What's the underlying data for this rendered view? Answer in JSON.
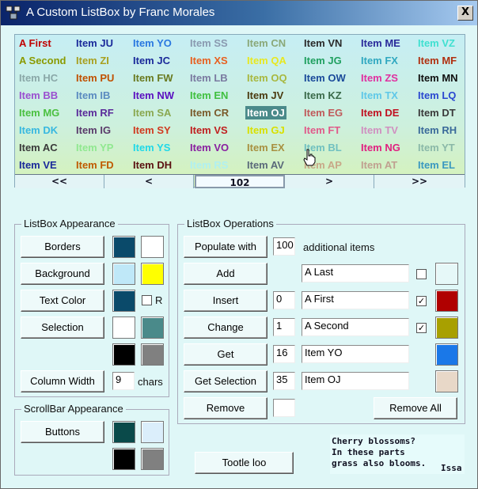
{
  "window": {
    "title": "A Custom ListBox by Franc Morales",
    "close_glyph": "X"
  },
  "listbox": {
    "columns": [
      [
        [
          "A First",
          "#c00000"
        ],
        [
          "A Second",
          "#8a9a00"
        ],
        [
          "Item HC",
          "#8aa8a8"
        ],
        [
          "Item BB",
          "#9a4fd0"
        ],
        [
          "Item MG",
          "#4bc040"
        ],
        [
          "Item DK",
          "#38b8e0"
        ],
        [
          "Item AC",
          "#3a3a3a"
        ],
        [
          "Item VE",
          "#1a2a9a"
        ]
      ],
      [
        [
          "Item JU",
          "#1a2a9a"
        ],
        [
          "Item ZI",
          "#a8a020"
        ],
        [
          "Item PU",
          "#c05000"
        ],
        [
          "Item IB",
          "#5a8ac0"
        ],
        [
          "Item RF",
          "#5a2a9a"
        ],
        [
          "Item IG",
          "#5a3a6a"
        ],
        [
          "Item YP",
          "#90e890"
        ],
        [
          "Item FD",
          "#c05a00"
        ]
      ],
      [
        [
          "Item YO",
          "#2a78e0"
        ],
        [
          "Item JC",
          "#1a2a9a"
        ],
        [
          "Item FW",
          "#6a7a20"
        ],
        [
          "Item NW",
          "#5a10c0"
        ],
        [
          "Item SA",
          "#8aa850"
        ],
        [
          "Item SY",
          "#d03a20"
        ],
        [
          "Item YS",
          "#20d8e8"
        ],
        [
          "Item DH",
          "#5a1010"
        ]
      ],
      [
        [
          "Item SS",
          "#8a9ab0"
        ],
        [
          "Item XS",
          "#e86020"
        ],
        [
          "Item LB",
          "#7a7aa0"
        ],
        [
          "Item EN",
          "#40c040"
        ],
        [
          "Item CR",
          "#7a5a2a"
        ],
        [
          "Item VS",
          "#c02020"
        ],
        [
          "Item VO",
          "#8a20a0"
        ],
        [
          "Item RS",
          "#b0f0f0"
        ]
      ],
      [
        [
          "Item CN",
          "#8aa878"
        ],
        [
          "Item QA",
          "#e8e820"
        ],
        [
          "Item OQ",
          "#a8b840"
        ],
        [
          "Item JV",
          "#4a3a10"
        ],
        [
          "Item OJ",
          "#ffffff"
        ],
        [
          "Item GJ",
          "#d8e000"
        ],
        [
          "Item EX",
          "#a89040"
        ],
        [
          "Item AV",
          "#5a6a7a"
        ]
      ],
      [
        [
          "Item VN",
          "#2a2a2a"
        ],
        [
          "Item JG",
          "#20a060"
        ],
        [
          "Item OW",
          "#1a4a9a"
        ],
        [
          "Item KZ",
          "#3a6a4a"
        ],
        [
          "Item EG",
          "#c05a5a"
        ],
        [
          "Item FT",
          "#e05a8a"
        ],
        [
          "Item BL",
          "#70c0c0"
        ],
        [
          "Item AP",
          "#c8a888"
        ]
      ],
      [
        [
          "Item ME",
          "#2a2a9a"
        ],
        [
          "Item FX",
          "#30a8c0"
        ],
        [
          "Item ZS",
          "#e030a0"
        ],
        [
          "Item TX",
          "#60c8e8"
        ],
        [
          "Item DE",
          "#c01020"
        ],
        [
          "Item TV",
          "#d090c0"
        ],
        [
          "Item NG",
          "#e02080"
        ],
        [
          "Item AT",
          "#c0a090"
        ]
      ],
      [
        [
          "Item VZ",
          "#40e0d0"
        ],
        [
          "Item MF",
          "#b03010"
        ],
        [
          "Item MN",
          "#101010"
        ],
        [
          "Item LQ",
          "#2a48d0"
        ],
        [
          "Item DT",
          "#3a3a3a"
        ],
        [
          "Item RH",
          "#3a6a9a"
        ],
        [
          "Item YT",
          "#8ab8a8"
        ],
        [
          "Item EL",
          "#3a98c0"
        ]
      ]
    ],
    "selected": "Item OJ",
    "nav": {
      "first": "<<",
      "prev": "<",
      "page": "102",
      "next": ">",
      "last": ">>"
    }
  },
  "appearance": {
    "title": "ListBox Appearance",
    "borders": "Borders",
    "background": "Background",
    "text_color": "Text Color",
    "r_label": "R",
    "selection": "Selection",
    "column_width": "Column Width",
    "column_width_value": "9",
    "chars": "chars",
    "colors": {
      "borders_a": "#0a4a6a",
      "borders_b": "#ffffff",
      "background_a": "#bfe8f8",
      "background_b": "#ffff00",
      "text_a": "#0a4a6a",
      "selection_a": "#ffffff",
      "selection_b": "#4a8a8a",
      "extra_a": "#000000",
      "extra_b": "#808080"
    }
  },
  "scrollbar": {
    "title": "ScrollBar Appearance",
    "buttons": "Buttons",
    "colors": {
      "btn_a": "#0a4a4a",
      "btn_b": "#dbeefb",
      "extra_a": "#000000",
      "extra_b": "#808080"
    }
  },
  "operations": {
    "title": "ListBox Operations",
    "populate": "Populate with",
    "populate_value": "100",
    "additional_items": "additional items",
    "add": "Add",
    "add_value": "A Last",
    "add_checked": "",
    "insert": "Insert",
    "insert_index": "0",
    "insert_value": "A First",
    "insert_checked": "✓",
    "change": "Change",
    "change_index": "1",
    "change_value": "A Second",
    "change_checked": "✓",
    "get": "Get",
    "get_index": "16",
    "get_value": "Item YO",
    "get_selection": "Get Selection",
    "get_selection_index": "35",
    "get_selection_value": "Item OJ",
    "remove": "Remove",
    "remove_value": "",
    "remove_all": "Remove All",
    "colors": {
      "add": "#e6f8f8",
      "insert": "#b00000",
      "change": "#a8a000",
      "get": "#1a78e8",
      "get_selection": "#e8d8c8"
    }
  },
  "footer": {
    "tootle": "Tootle loo",
    "haiku": [
      "Cherry blossoms?",
      "In these parts",
      "grass also blooms."
    ],
    "author": "Issa"
  }
}
